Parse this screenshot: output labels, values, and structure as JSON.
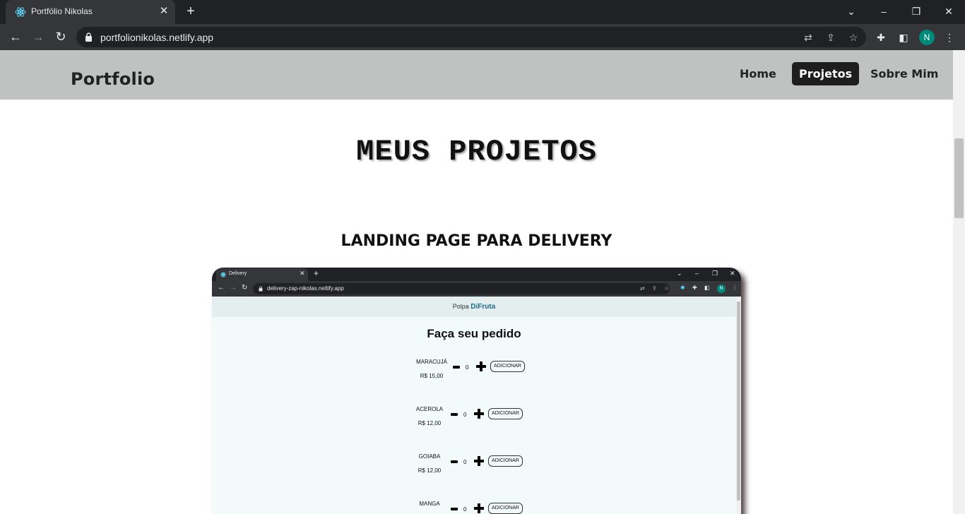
{
  "browser": {
    "tab_title": "Portfólio Nikolas",
    "url": "portfolionikolas.netlify.app",
    "profile_initial": "N"
  },
  "site": {
    "logo": "Portfolio",
    "nav": {
      "home": "Home",
      "projetos": "Projetos",
      "sobre": "Sobre Mim"
    },
    "page_title": "MEUS PROJETOS",
    "project_title": "LANDING PAGE PARA DELIVERY"
  },
  "preview": {
    "tab_title": "Delivery",
    "url": "delivery-zap-nikolas.netlify.app",
    "profile_initial": "N",
    "brand_prefix": "Polpa",
    "brand_name": "DiFruta",
    "heading": "Faça seu pedido",
    "add_label": "ADICIONAR",
    "items": [
      {
        "name": "MARACUJÁ",
        "price": "R$ 15,00",
        "qty": "0"
      },
      {
        "name": "ACEROLA",
        "price": "R$ 12,00",
        "qty": "0"
      },
      {
        "name": "GOIABA",
        "price": "R$ 12,00",
        "qty": "0"
      },
      {
        "name": "MANGA",
        "price": "",
        "qty": "0"
      }
    ]
  },
  "colors": {
    "header_bg": "#c0c2c1",
    "active_nav_bg": "#1e1e1e",
    "brand_accent": "#1b6b8a"
  }
}
